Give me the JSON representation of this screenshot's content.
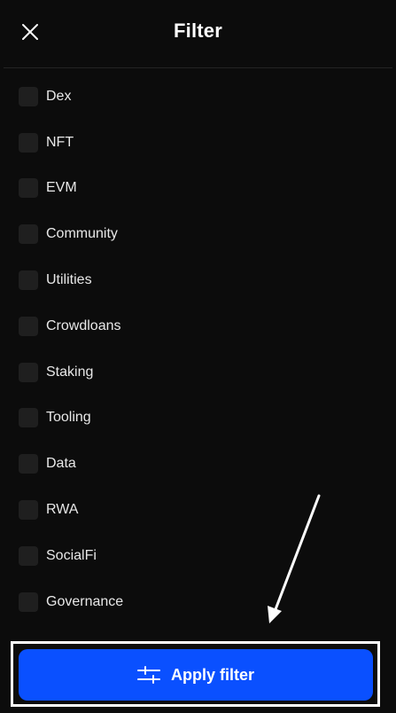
{
  "header": {
    "title": "Filter",
    "close_icon": "close-icon"
  },
  "filters": [
    {
      "label": "Dex",
      "checked": false
    },
    {
      "label": "NFT",
      "checked": false
    },
    {
      "label": "EVM",
      "checked": false
    },
    {
      "label": "Community",
      "checked": false
    },
    {
      "label": "Utilities",
      "checked": false
    },
    {
      "label": "Crowdloans",
      "checked": false
    },
    {
      "label": "Staking",
      "checked": false
    },
    {
      "label": "Tooling",
      "checked": false
    },
    {
      "label": "Data",
      "checked": false
    },
    {
      "label": "RWA",
      "checked": false
    },
    {
      "label": "SocialFi",
      "checked": false
    },
    {
      "label": "Governance",
      "checked": false
    }
  ],
  "footer": {
    "apply_label": "Apply filter",
    "apply_icon": "sliders-icon"
  },
  "colors": {
    "background": "#0c0c0c",
    "accent": "#0a50ff",
    "checkbox": "#1f1f1f",
    "highlight": "#ffffff"
  }
}
